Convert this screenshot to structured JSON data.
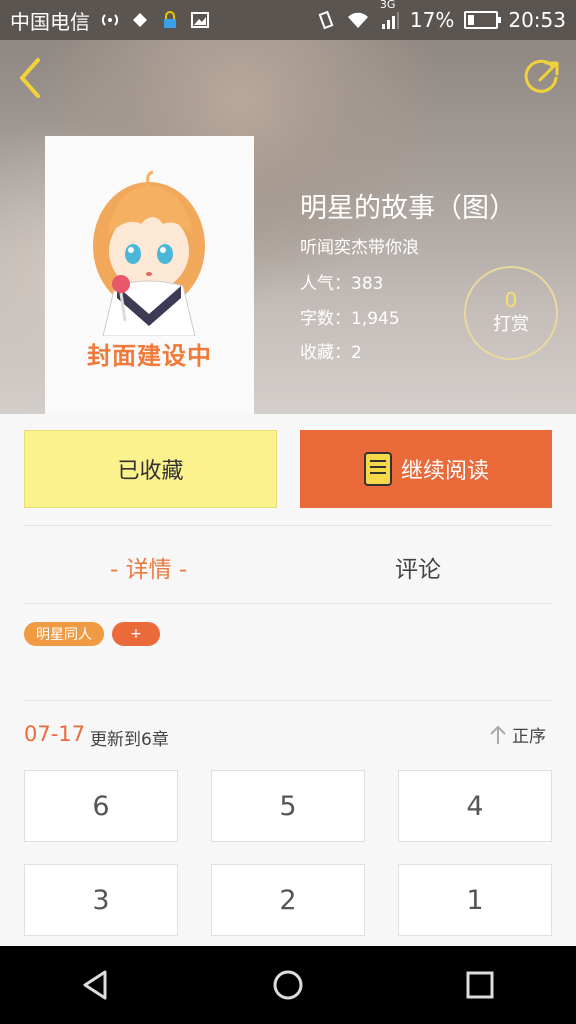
{
  "status_bar": {
    "carrier": "中国电信",
    "network": "3G",
    "battery": "17%",
    "time": "20:53"
  },
  "book": {
    "cover_label": "封面建设中",
    "title": "明星的故事（图）",
    "author": "听闻奕杰带你浪",
    "popularity": "人气：383",
    "words": "字数：1,945",
    "favorites": "收藏：2",
    "reward_count": "0",
    "reward_label": "打赏"
  },
  "actions": {
    "collected_label": "已收藏",
    "continue_label": "继续阅读"
  },
  "tabs": {
    "details": "- 详情 -",
    "comments": "评论"
  },
  "tags": {
    "tag1": "明星同人",
    "add": "+"
  },
  "update": {
    "date": "07-17",
    "text": "更新到6章",
    "sort_label": "正序"
  },
  "chapters": [
    "6",
    "5",
    "4",
    "3",
    "2",
    "1"
  ],
  "colors": {
    "accent": "#ea6a3a",
    "collected_bg": "#fbf28e",
    "reward_accent": "#f5e06c"
  }
}
